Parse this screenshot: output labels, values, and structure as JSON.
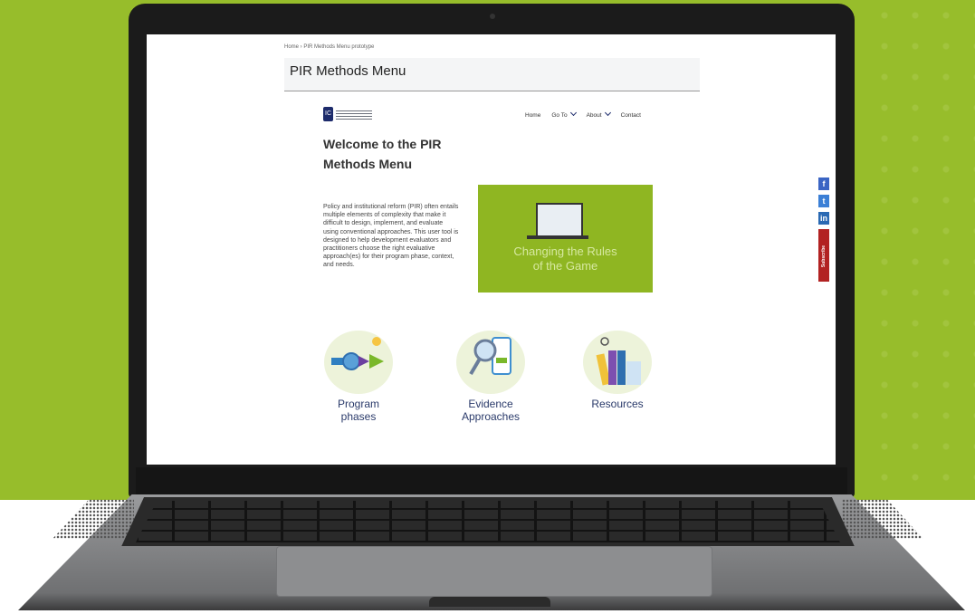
{
  "breadcrumb": "Home › PIR Methods Menu prototype",
  "page_title": "PIR Methods Menu",
  "nav": {
    "home": "Home",
    "goto": "Go To",
    "about": "About",
    "contact": "Contact"
  },
  "welcome": {
    "line1": "Welcome to the PIR",
    "line2": "Methods Menu"
  },
  "intro_text": "Policy and institutional reform (PIR) often entails multiple elements of complexity that make it difficult to design, implement, and evaluate using conventional approaches. This user tool is designed to help development evaluators and practitioners choose the right evaluative approach(es) for their program phase, context, and needs.",
  "video": {
    "line1": "Changing the Rules",
    "line2": "of the Game"
  },
  "social": {
    "facebook": "f",
    "twitter": "t",
    "linkedin": "in",
    "subscribe": "Subscribe"
  },
  "cards": [
    {
      "line1": "Program",
      "line2": "phases"
    },
    {
      "line1": "Evidence",
      "line2": "Approaches"
    },
    {
      "line1": "Resources",
      "line2": ""
    }
  ],
  "colors": {
    "background_green": "#97bd2b",
    "brand_navy": "#1d2b6b",
    "subscribe_red": "#b22222"
  }
}
